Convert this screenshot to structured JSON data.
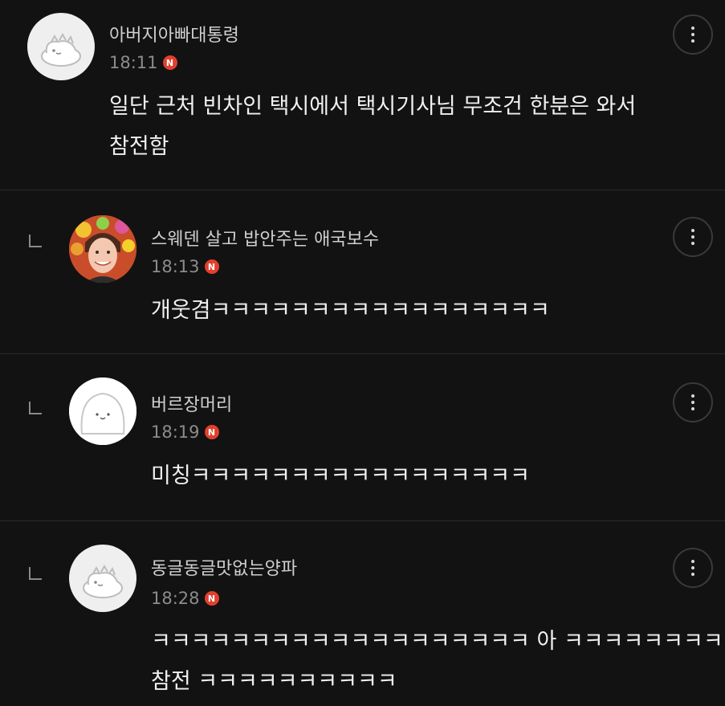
{
  "comments": [
    {
      "author": "아버지아빠대통령",
      "time": "18:11",
      "badge": "N",
      "lines": [
        "일단 근처 빈차인 택시에서 택시기사님 무조건 한분은 와서",
        "참전함"
      ],
      "avatar_icon": "dinosaur-avatar-icon"
    },
    {
      "author": "스웨덴 살고 밥안주는 애국보수",
      "time": "18:13",
      "badge": "N",
      "lines": [
        "개웃겸ㅋㅋㅋㅋㅋㅋㅋㅋㅋㅋㅋㅋㅋㅋㅋㅋㅋ"
      ],
      "avatar_icon": "person-photo-avatar-icon"
    },
    {
      "author": "버르장머리",
      "time": "18:19",
      "badge": "N",
      "lines": [
        "미칭ㅋㅋㅋㅋㅋㅋㅋㅋㅋㅋㅋㅋㅋㅋㅋㅋㅋ"
      ],
      "avatar_icon": "cute-face-avatar-icon"
    },
    {
      "author": "동글동글맛없는양파",
      "time": "18:28",
      "badge": "N",
      "lines": [
        "ㅋㅋㅋㅋㅋㅋㅋㅋㅋㅋㅋㅋㅋㅋㅋㅋㅋㅋㅋ 아 ㅋㅋㅋㅋㅋㅋㅋㅋㅋ",
        "참전 ㅋㅋㅋㅋㅋㅋㅋㅋㅋㅋ"
      ],
      "avatar_icon": "dinosaur-avatar-icon"
    }
  ],
  "colors": {
    "background": "#121212",
    "badge": "#e2402f",
    "divider": "#2a2a2a"
  }
}
